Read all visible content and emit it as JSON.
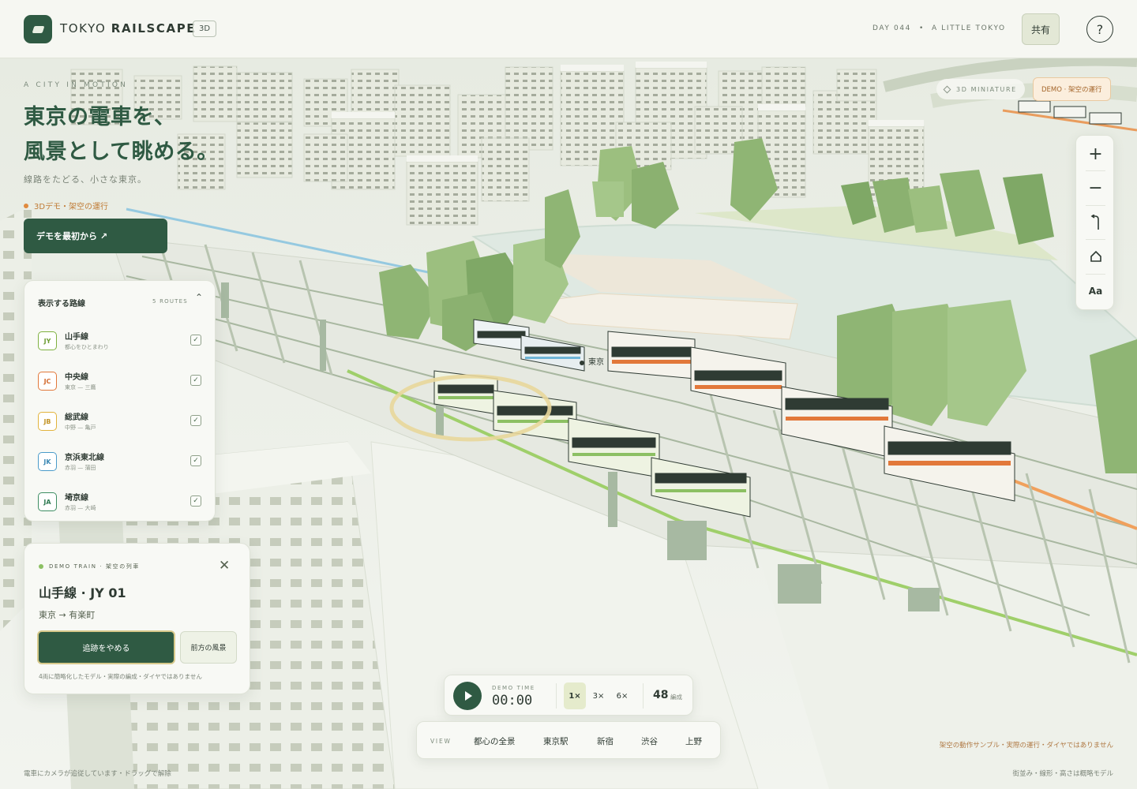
{
  "header": {
    "brand_light": "TOKYO ",
    "brand_bold": "RAILSCAPE",
    "mode_badge": "3D",
    "day": "DAY 044",
    "separator": "•",
    "tagline": "A LITTLE TOKYO",
    "share_label": "共有",
    "help_label": "?"
  },
  "hero": {
    "eyebrow": "A CITY IN MOTION",
    "headline_line1": "東京の電車を、",
    "headline_line2": "風景として眺める。",
    "subline": "線路をたどる、小さな東京。",
    "demo_note": "3Dデモ・架空の運行",
    "restart_label": "デモを最初から ↗"
  },
  "routes_panel": {
    "title": "表示する路線",
    "count": "5 ROUTES",
    "collapse_icon": "chevron-up",
    "routes": [
      {
        "code": "JY",
        "name": "山手線",
        "sub": "都心をひとまわり",
        "color": "#7fb140",
        "checked": true
      },
      {
        "code": "JC",
        "name": "中央線",
        "sub": "東京 — 三鷹",
        "color": "#e2783a",
        "checked": true
      },
      {
        "code": "JB",
        "name": "総武線",
        "sub": "中野 — 亀戸",
        "color": "#e2b33c",
        "checked": true
      },
      {
        "code": "JK",
        "name": "京浜東北線",
        "sub": "赤羽 — 蒲田",
        "color": "#4a9bc9",
        "checked": true
      },
      {
        "code": "JA",
        "name": "埼京線",
        "sub": "赤羽 — 大崎",
        "color": "#3d8d62",
        "checked": true
      }
    ]
  },
  "train_card": {
    "eyebrow": "DEMO TRAIN · 架空の列車",
    "title": "山手線 · JY 01",
    "route": "東京 → 有楽町",
    "follow_label": "追跡をやめる",
    "front_label": "前方の風景",
    "note": "4両に簡略化したモデル・実際の編成・ダイヤではありません",
    "close_label": "✕"
  },
  "map_overlay": {
    "mini_label": "3D MINIATURE",
    "demo_badge": "DEMO · 架空の運行",
    "station_label": "東京",
    "controls": [
      "zoom-in",
      "zoom-out",
      "rotate",
      "home",
      "text-size"
    ],
    "text_size_label": "Aa"
  },
  "playback": {
    "label": "DEMO TIME",
    "time": "00:00",
    "speeds": [
      "1×",
      "3×",
      "6×"
    ],
    "active_speed": "1×",
    "train_count": "48",
    "train_unit": "編成"
  },
  "view_bar": {
    "label": "VIEW",
    "items": [
      "都心の全景",
      "東京駅",
      "新宿",
      "渋谷",
      "上野"
    ]
  },
  "footer": {
    "left": "電車にカメラが追従しています・ドラッグで解除",
    "right_note": "架空の動作サンプル・実際の運行・ダイヤではありません",
    "right_model": "街並み・線形・高さは概略モデル"
  },
  "colors": {
    "brand_green": "#2f5a43",
    "panel_bg": "#f8f9f5",
    "yamanote": "#7fb140",
    "chuo": "#e2783a",
    "accent_orange": "#e08a3e"
  }
}
